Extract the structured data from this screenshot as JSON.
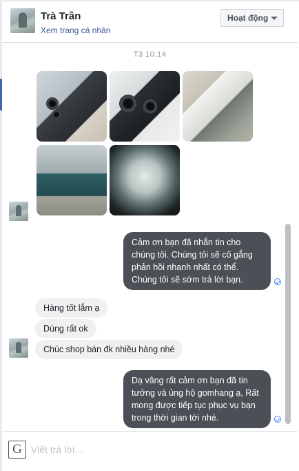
{
  "header": {
    "name": "Trà Trần",
    "profile_link": "Xem trang cá nhân",
    "status_button": "Hoạt động"
  },
  "thread": {
    "timestamp": "T3 10:14",
    "outgoing": [
      "Cảm ơn bạn đã nhắn tin cho chúng tôi. Chúng tôi sẽ cố gắng phản hồi nhanh nhất có thể. Chúng tôi sẽ sớm trả lời bạn.",
      "Dạ vâng rất cảm ơn bạn đã tin tưởng và ủng hộ gomhang ạ, Rất mong được tiếp tục phục vụ bạn trong thời gian tới nhé."
    ],
    "incoming": [
      "Hàng tốt lắm ạ",
      "Dùng rất ok",
      "Chúc shop bán đk nhiều hàng nhé"
    ]
  },
  "composer": {
    "placeholder": "Viết trả lời...",
    "g_icon_glyph": "G"
  },
  "colors": {
    "outgoing_bubble": "#4b4f56",
    "incoming_bubble": "#f1f0f0",
    "link": "#365899",
    "seen": "#4080ff"
  }
}
